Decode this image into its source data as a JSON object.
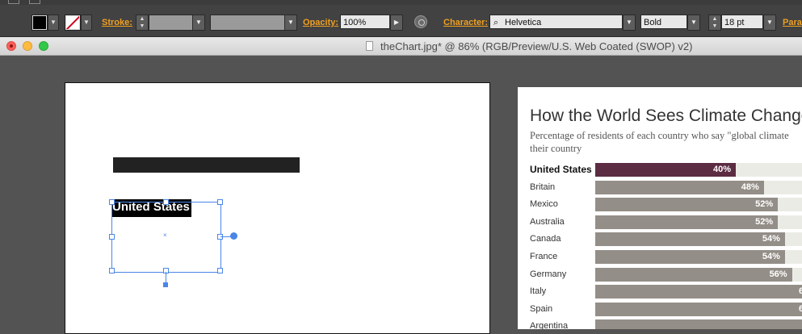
{
  "control_bar": {
    "stroke_label": "Stroke:",
    "opacity_label": "Opacity:",
    "opacity_value": "100%",
    "character_label": "Character:",
    "font_family": "Helvetica",
    "font_style": "Bold",
    "font_size": "18 pt",
    "paragraph_label": "Parag"
  },
  "window": {
    "title": "theChart.jpg* @ 86% (RGB/Preview/U.S. Web Coated (SWOP) v2)"
  },
  "artboard": {
    "selected_text": "United States"
  },
  "reference_chart": {
    "title": "How the World Sees Climate Change",
    "subtitle_line1": "Percentage of residents of each country who say \"global climate",
    "subtitle_line2": "their country"
  },
  "chart_data": {
    "type": "bar",
    "title": "How the World Sees Climate Change",
    "categories": [
      "United States",
      "Britain",
      "Mexico",
      "Australia",
      "Canada",
      "France",
      "Germany",
      "Italy",
      "Spain",
      "Argentina"
    ],
    "values": [
      40,
      48,
      52,
      52,
      54,
      54,
      56,
      null,
      null,
      null
    ],
    "value_labels": [
      "40%",
      "48%",
      "52%",
      "52%",
      "54%",
      "54%",
      "56%",
      "6",
      "6",
      ""
    ],
    "highlight_color": "#5b2c42",
    "bar_color": "#938e87",
    "track_color": "#ebebe6"
  },
  "colors": {
    "accent": "#f0a020",
    "selection": "#4a86e8"
  }
}
